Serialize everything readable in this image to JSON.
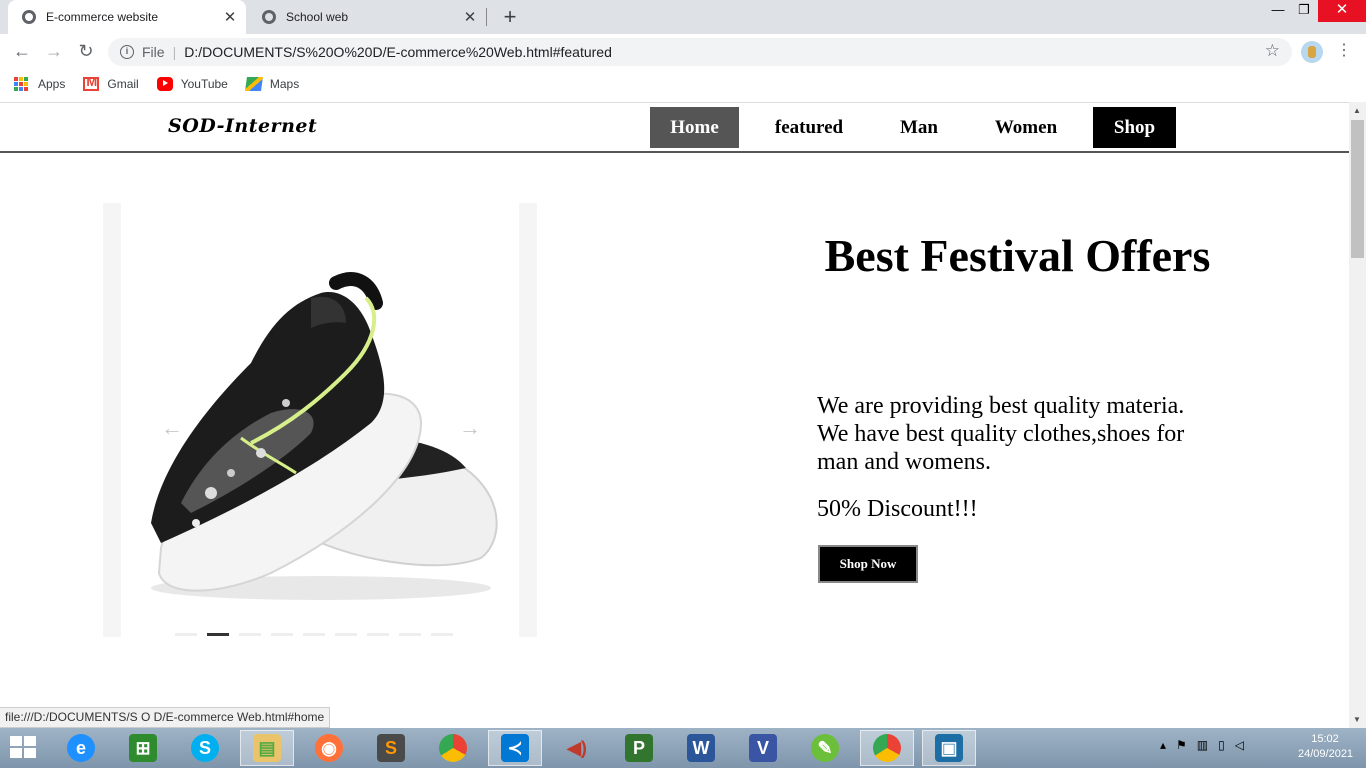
{
  "browser": {
    "tabs": [
      {
        "title": "E-commerce website",
        "active": true
      },
      {
        "title": "School web",
        "active": false
      }
    ],
    "address": {
      "scheme": "File",
      "url": "D:/DOCUMENTS/S%20O%20D/E-commerce%20Web.html#featured"
    },
    "bookmarks": [
      "Apps",
      "Gmail",
      "YouTube",
      "Maps"
    ],
    "status_url": "file:///D:/DOCUMENTS/S O D/E-commerce Web.html#home"
  },
  "site": {
    "logo": "SOD-Internet",
    "nav": [
      "Home",
      "featured",
      "Man",
      "Women",
      "Shop"
    ],
    "offer": {
      "title": "Best Festival Offers",
      "text": "We are providing best quality materia. We have best quality clothes,shoes for man and womens.",
      "discount": "50% Discount!!!",
      "button": "Shop Now"
    },
    "slider": {
      "active_dot": 2,
      "dot_count": 9
    }
  },
  "taskbar": {
    "time": "15:02",
    "date": "24/09/2021",
    "apps": [
      "internet-explorer",
      "store",
      "skype",
      "file-explorer",
      "firefox",
      "sublime-text",
      "chrome",
      "vscode",
      "volume",
      "project",
      "word",
      "visio",
      "edit",
      "chrome-alt",
      "photos"
    ]
  },
  "colors": {
    "nav_home_bg": "#555555",
    "nav_shop_bg": "#000000",
    "taskbar": "#8ea4b9",
    "close_red": "#e81123"
  }
}
